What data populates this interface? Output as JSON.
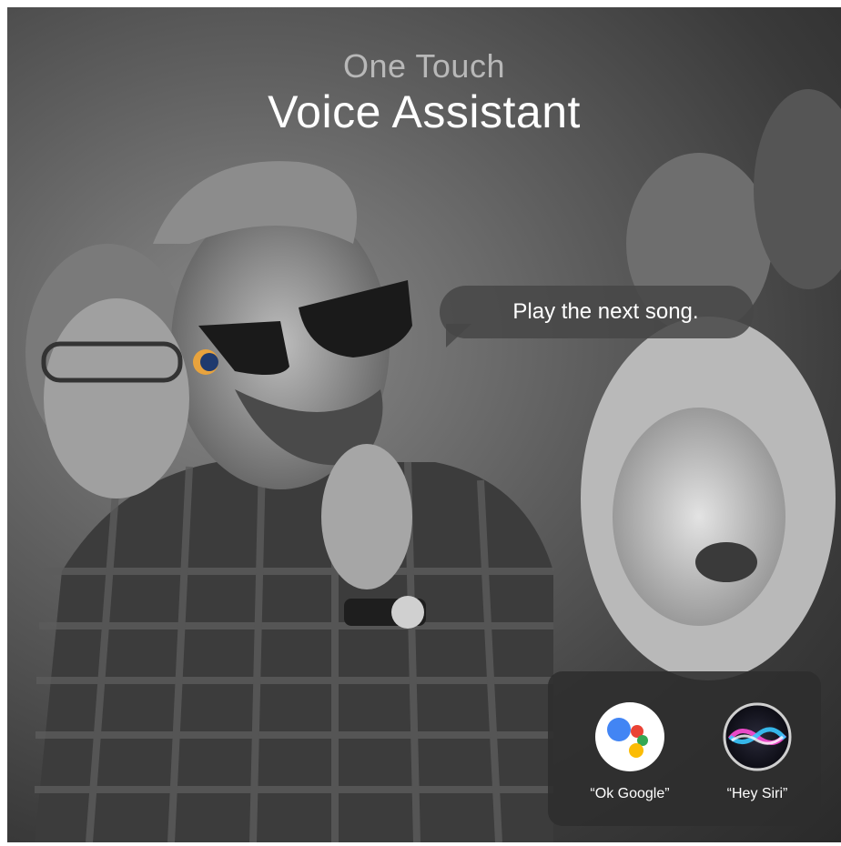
{
  "header": {
    "subtitle": "One Touch",
    "title": "Voice Assistant"
  },
  "speech_bubble": {
    "text": "Play the next song."
  },
  "assistants": [
    {
      "label": "“Ok Google”",
      "icon": "google-assistant-icon"
    },
    {
      "label": "“Hey Siri”",
      "icon": "siri-icon"
    }
  ],
  "colors": {
    "google_blue": "#4285F4",
    "google_red": "#EA4335",
    "google_yellow": "#FBBC05",
    "google_green": "#34A853",
    "earbud_accent": "#E8A33D"
  }
}
